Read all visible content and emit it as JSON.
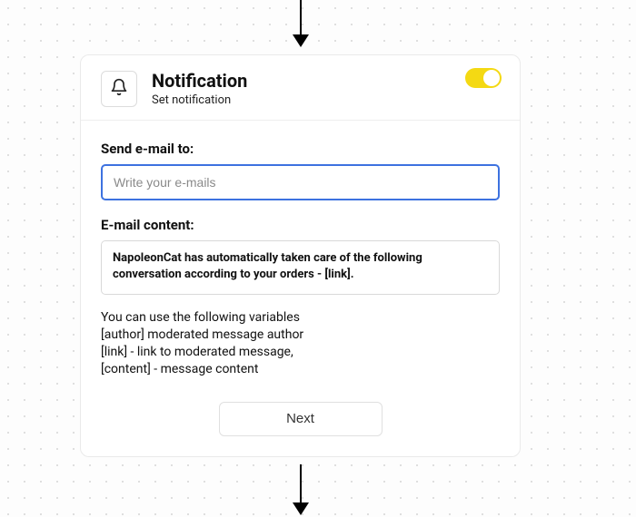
{
  "header": {
    "title": "Notification",
    "subtitle": "Set notification",
    "icon": "bell-icon",
    "toggle_on": true
  },
  "form": {
    "email_label": "Send e-mail to:",
    "email_placeholder": "Write your e-mails",
    "email_value": "",
    "content_label": "E-mail content:",
    "content_value": "NapoleonCat has automatically taken care of the following conversation according to your orders - [link]."
  },
  "hint": {
    "line1": "You can use the following variables",
    "line2": "[author] moderated message author",
    "line3": "[link] - link to moderated message,",
    "line4": "[content] - message content"
  },
  "actions": {
    "next_label": "Next"
  }
}
